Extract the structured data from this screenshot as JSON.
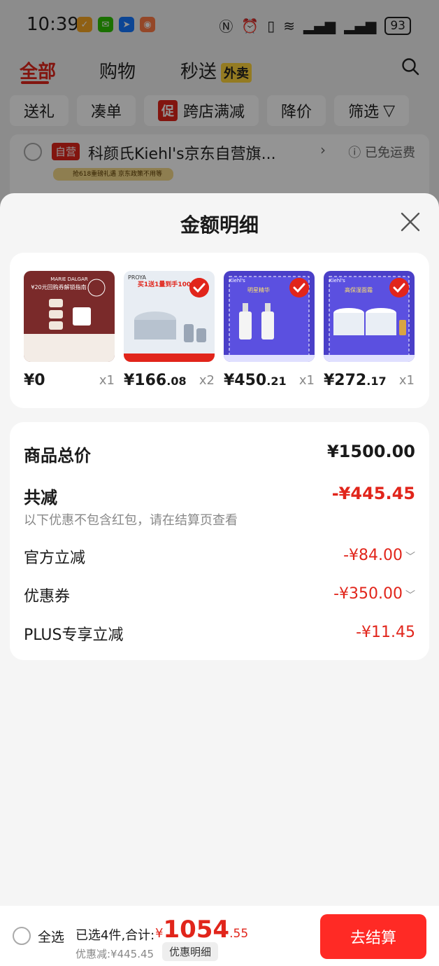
{
  "status_bar": {
    "time": "10:39",
    "battery": "93",
    "app_icons": [
      "notification-app-icon",
      "wechat-icon",
      "pay-app-icon",
      "camera-app-icon"
    ],
    "system_icons": [
      "nfc-icon",
      "alarm-icon",
      "vibrate-icon",
      "wifi-icon",
      "signal-icon",
      "signal-icon"
    ]
  },
  "background_page": {
    "tabs": [
      {
        "label": "全部",
        "active": true
      },
      {
        "label": "购物",
        "active": false
      },
      {
        "label": "秒送",
        "active": false
      }
    ],
    "takeout_badge": "外卖",
    "filters": [
      "送礼",
      "凑单",
      "跨店满减",
      "降价",
      "筛选"
    ],
    "promo_badge": "促",
    "store": {
      "self_badge": "自营",
      "name": "科颜氏Kiehl's京东自营旗...",
      "shipping": "已免运费",
      "promo_strip": "抢618重磅礼遇 京东政策不用等"
    }
  },
  "sheet": {
    "title": "金额明细",
    "products": [
      {
        "price_int": "¥0",
        "price_dec": "",
        "qty": "x1",
        "checked": false,
        "image_desc": "MARIE DALGAR",
        "image_caption": "¥20元回购券解锁指南"
      },
      {
        "price_int": "¥166",
        "price_dec": ".08",
        "qty": "x2",
        "checked": true,
        "image_desc": "PROYA",
        "image_caption": "买1送1量到手100"
      },
      {
        "price_int": "¥450",
        "price_dec": ".21",
        "qty": "x1",
        "checked": true,
        "image_desc": "Kiehl's",
        "image_caption": "明星精华"
      },
      {
        "price_int": "¥272",
        "price_dec": ".17",
        "qty": "x1",
        "checked": true,
        "image_desc": "Kiehl's",
        "image_caption": "高保湿面霜"
      }
    ],
    "summary": {
      "total_label": "商品总价",
      "total_value": "¥1500.00",
      "discount_label": "共减",
      "discount_value": "-¥445.45",
      "note": "以下优惠不包含红包，请在结算页查看",
      "items": [
        {
          "label": "官方立减",
          "value": "-¥84.00",
          "expandable": true
        },
        {
          "label": "优惠券",
          "value": "-¥350.00",
          "expandable": true
        },
        {
          "label": "PLUS专享立减",
          "value": "-¥11.45",
          "expandable": false
        }
      ]
    }
  },
  "bottom_bar": {
    "select_all": "全选",
    "selected_text": "已选4件,合计:",
    "total_currency": "¥",
    "total_int": "1054",
    "total_dec": ".55",
    "discount_text": "优惠减:¥445.45",
    "detail_button": "优惠明细",
    "checkout_button": "去结算"
  },
  "colors": {
    "accent": "#e1251b",
    "checkout": "#ff2a25",
    "background": "#f5f5f5"
  }
}
